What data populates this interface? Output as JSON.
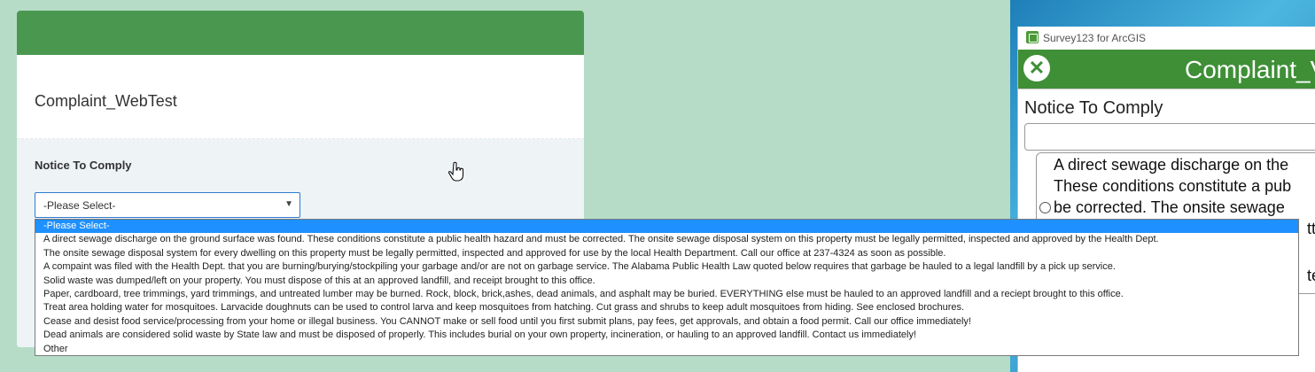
{
  "form": {
    "title": "Complaint_WebTest",
    "question_label": "Notice To Comply",
    "select_value": "-Please Select-",
    "arrow": "▼"
  },
  "dropdown": {
    "options": [
      "-Please Select-",
      "A direct sewage discharge on the ground surface was found. These conditions constitute a public health hazard and must be corrected. The onsite sewage disposal system on this property must be legally permitted, inspected and approved by the Health Dept.",
      "The onsite sewage disposal system for every dwelling on this property must be legally permitted, inspected and approved for use by the local Health Department. Call our office at 237-4324 as soon as possible.",
      "A compaint was filed with the Health Dept. that you are burning/burying/stockpiling your garbage and/or are not on garbage service. The Alabama Public Health Law quoted below requires that garbage be hauled to a legal landfill by a pick up service.",
      "Solid waste was dumped/left on your property. You must dispose of this at an approved landfill, and receipt brought to this office.",
      "Paper, cardboard, tree trimmings, yard trimmings, and untreated lumber may be burned. Rock, block, brick,ashes, dead animals, and asphalt may be buried. EVERYTHING else must be hauled to an approved landfill and a reciept brought to this office.",
      "Treat area holding water for mosquitoes. Larvacide doughnuts can be used to control larva and keep mosquitoes from hatching. Cut grass and shrubs to keep adult mosquitoes from hiding. See enclosed brochures.",
      "Cease and desist food service/processing from your home or illegal business. You CANNOT make or sell food until you first submit plans, pay fees, get approvals, and obtain a food permit. Call our office immediately!",
      "Dead animals are considered solid waste by State law and must be disposed of properly. This includes burial on your own property, incineration, or hauling to an approved landfill. Contact us immediately!",
      "Other"
    ],
    "selected_index": 0
  },
  "survey_window": {
    "app_title": "Survey123 for ArcGIS",
    "heading": "Complaint_V",
    "close_glyph": "✕",
    "question_label": "Notice To Comply",
    "choice_lines": [
      "A direct sewage discharge on the",
      "These conditions constitute a pub",
      "be corrected. The onsite sewage",
      "tte",
      "te"
    ]
  },
  "colors": {
    "header_green": "#4a9850",
    "background": "#b6dcc7",
    "selected_blue": "#1e90ff",
    "survey_green": "#3f8f37"
  },
  "icons": {
    "cursor": "hand-pointer-icon",
    "close": "close-icon",
    "app": "survey123-icon",
    "dropdown_arrow": "chevron-down-icon"
  }
}
